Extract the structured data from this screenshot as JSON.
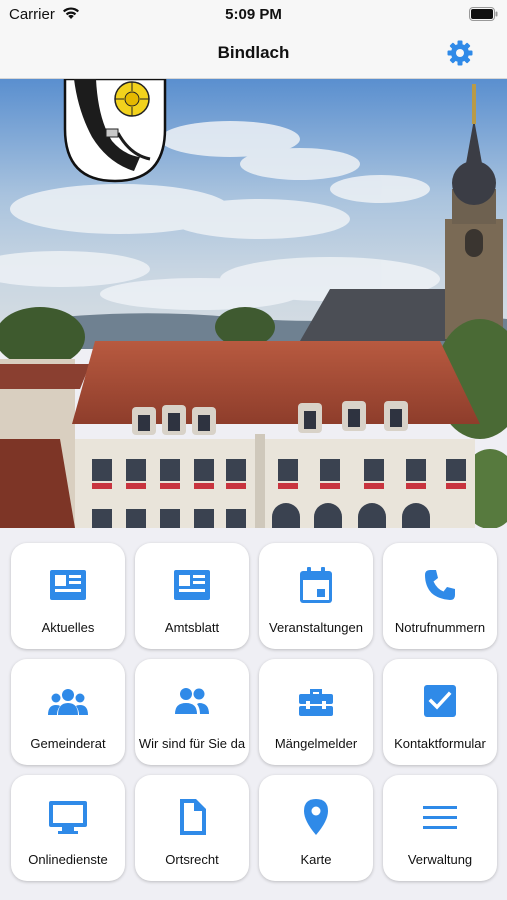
{
  "status_bar": {
    "carrier": "Carrier",
    "time": "5:09 PM"
  },
  "nav": {
    "title": "Bindlach"
  },
  "accent_color": "#2f8ae8",
  "tiles": [
    {
      "label": "Aktuelles",
      "icon": "newspaper-icon"
    },
    {
      "label": "Amtsblatt",
      "icon": "newspaper-icon"
    },
    {
      "label": "Veranstaltungen",
      "icon": "calendar-icon"
    },
    {
      "label": "Notrufnummern",
      "icon": "phone-icon"
    },
    {
      "label": "Gemeinderat",
      "icon": "group-icon"
    },
    {
      "label": "Wir sind für Sie da",
      "icon": "people-icon"
    },
    {
      "label": "Mängelmelder",
      "icon": "toolbox-icon"
    },
    {
      "label": "Kontaktformular",
      "icon": "checkbox-icon"
    },
    {
      "label": "Onlinedienste",
      "icon": "monitor-icon"
    },
    {
      "label": "Ortsrecht",
      "icon": "document-icon"
    },
    {
      "label": "Karte",
      "icon": "map-pin-icon"
    },
    {
      "label": "Verwaltung",
      "icon": "menu-icon"
    }
  ]
}
